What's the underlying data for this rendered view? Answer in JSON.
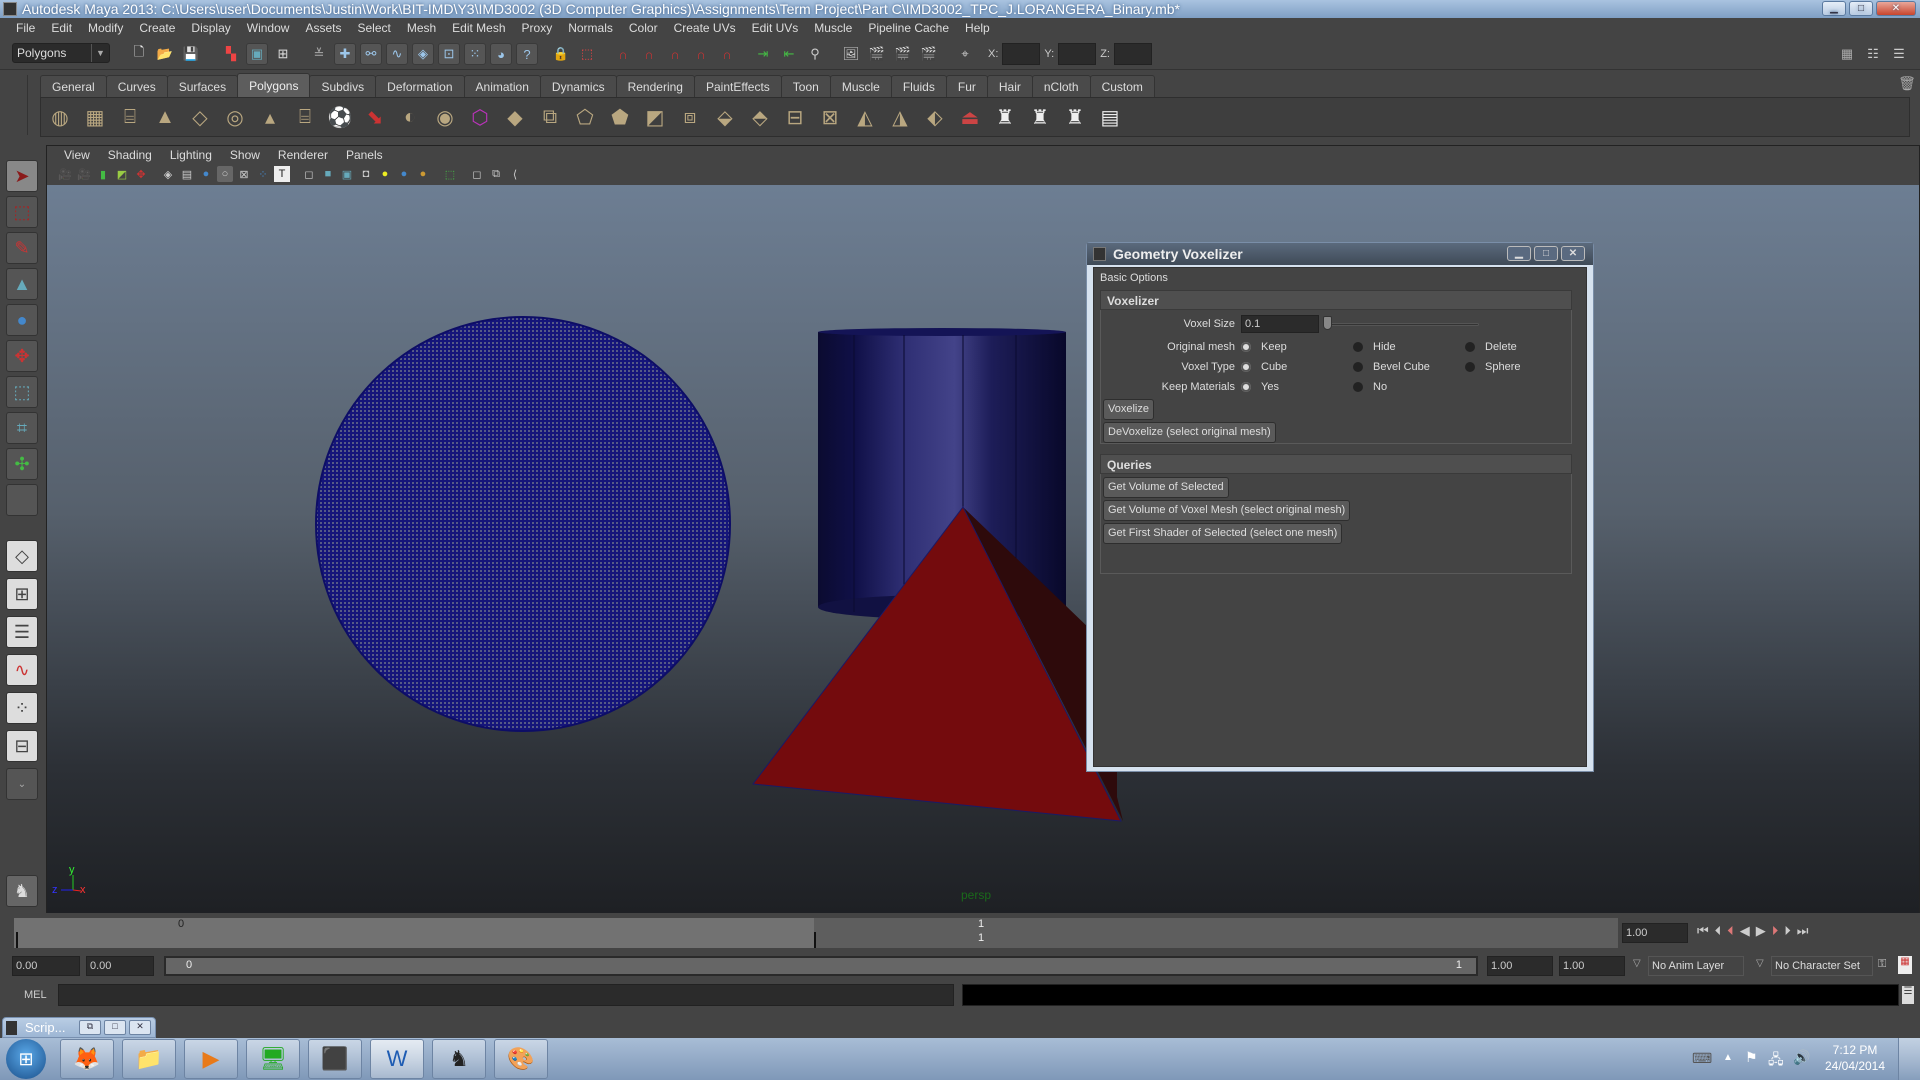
{
  "window": {
    "title": "Autodesk Maya 2013: C:\\Users\\user\\Documents\\Justin\\Work\\BIT-IMD\\Y3\\IMD3002 (3D Computer Graphics)\\Assignments\\Term Project\\Part C\\IMD3002_TPC_J.LORANGERA_Binary.mb*",
    "controls": [
      "minimize",
      "maximize",
      "close"
    ]
  },
  "menubar": [
    "File",
    "Edit",
    "Modify",
    "Create",
    "Display",
    "Window",
    "Assets",
    "Select",
    "Mesh",
    "Edit Mesh",
    "Proxy",
    "Normals",
    "Color",
    "Create UVs",
    "Edit UVs",
    "Muscle",
    "Pipeline Cache",
    "Help"
  ],
  "statusline": {
    "mode": "Polygons",
    "icons": [
      "new-scene",
      "open-scene",
      "save-scene",
      "select-by-hierarchy",
      "select-by-object",
      "select-by-component",
      "snap-grid",
      "snap-curve",
      "snap-point",
      "snap-view-plane",
      "snap-live",
      "snap-surface",
      "snap-dynamics",
      "help-query",
      "lock",
      "select-highlight",
      "history-1",
      "history-2",
      "history-3",
      "history-4",
      "history-5",
      "input-ops",
      "output-ops",
      "construction-history",
      "render-view",
      "render-current",
      "ipr-render",
      "render-settings",
      "transform-input"
    ],
    "coords": {
      "x_label": "X:",
      "y_label": "Y:",
      "z_label": "Z:",
      "x": "",
      "y": "",
      "z": ""
    },
    "right_icons": [
      "attribute-editor",
      "tool-settings",
      "channel-box"
    ]
  },
  "shelf": {
    "tabs": [
      "General",
      "Curves",
      "Surfaces",
      "Polygons",
      "Subdivs",
      "Deformation",
      "Animation",
      "Dynamics",
      "Rendering",
      "PaintEffects",
      "Toon",
      "Muscle",
      "Fluids",
      "Fur",
      "Hair",
      "nCloth",
      "Custom"
    ],
    "active_tab": "Polygons",
    "icons": [
      "poly-sphere",
      "poly-cube",
      "poly-cylinder",
      "poly-cone",
      "poly-plane",
      "poly-torus",
      "poly-pyramid",
      "poly-pipe",
      "poly-soccer-ball",
      "separate",
      "combine",
      "smooth",
      "extract",
      "booleans",
      "mirror",
      "create-polygon",
      "append-polygon",
      "extrude",
      "bridge",
      "bevel",
      "split-polygon",
      "insert-edge-loop",
      "offset-edge-loop",
      "poke",
      "wedge",
      "sculpt",
      "planar-mapping",
      "cylindrical-mapping",
      "spherical-mapping",
      "automatic-mapping",
      "uv-editor"
    ],
    "trash_icon": "trash-icon"
  },
  "toolbox": [
    "select-tool",
    "lasso-tool",
    "paint-select-tool",
    "move-tool",
    "rotate-tool",
    "scale-tool",
    "universal-manipulator",
    "soft-mod-tool",
    "show-manipulator",
    "last-tool",
    "single-perspective-layout",
    "four-view-layout",
    "outliner-persp-layout",
    "persp-graph-layout",
    "hypershade-persp-layout",
    "persp-graph-hyper-layout",
    "more-layouts"
  ],
  "viewport": {
    "menu": [
      "View",
      "Shading",
      "Lighting",
      "Show",
      "Renderer",
      "Panels"
    ],
    "camera_label": "persp",
    "axis": {
      "x": "x",
      "y": "y",
      "z": "z"
    },
    "scene_objects": [
      {
        "name": "voxelized-sphere",
        "color": "#0d0d66"
      },
      {
        "name": "cylinder",
        "color": "#3a3a82"
      },
      {
        "name": "pyramid",
        "color": "#740b0d"
      }
    ]
  },
  "dialog": {
    "title": "Geometry Voxelizer",
    "menu": "Basic Options",
    "voxelizer": {
      "header": "Voxelizer",
      "voxel_size_label": "Voxel Size",
      "voxel_size": "0.1",
      "voxel_size_slider": 0.0,
      "original_mesh": {
        "label": "Original mesh",
        "options": [
          "Keep",
          "Hide",
          "Delete"
        ],
        "selected": "Keep"
      },
      "voxel_type": {
        "label": "Voxel Type",
        "options": [
          "Cube",
          "Bevel Cube",
          "Sphere"
        ],
        "selected": "Cube"
      },
      "keep_materials": {
        "label": "Keep Materials",
        "options": [
          "Yes",
          "No"
        ],
        "selected": "Yes"
      },
      "voxelize_btn": "Voxelize",
      "devoxelize_btn": "DeVoxelize (select original mesh)"
    },
    "queries": {
      "header": "Queries",
      "buttons": [
        "Get Volume of Selected",
        "Get Volume of Voxel Mesh (select original mesh)",
        "Get First Shader of Selected (select one mesh)"
      ]
    }
  },
  "timeline": {
    "start_tick": "0",
    "current_frame_top": "1",
    "current_frame_bottom": "1",
    "current_time": "1.00",
    "playback": [
      "go-to-start",
      "step-back-frame",
      "step-back-key",
      "play-backwards",
      "play-forwards",
      "step-forward-key",
      "step-forward-frame",
      "go-to-end"
    ]
  },
  "range": {
    "start_time": "0.00",
    "playback_start": "0.00",
    "slider_start": "0",
    "slider_end": "1",
    "playback_end": "1.00",
    "end_time": "1.00",
    "anim_layer": "No Anim Layer",
    "character_set": "No Character Set"
  },
  "commandline": {
    "label": "MEL",
    "input": "",
    "result": ""
  },
  "script_editor_mini": {
    "label": "Scrip..."
  },
  "taskbar": {
    "apps": [
      "start-button",
      "firefox",
      "file-explorer",
      "media-player",
      "resource-monitor",
      "adobe-reader",
      "microsoft-word",
      "autodesk-maya",
      "paint"
    ],
    "time": "7:12 PM",
    "date": "24/04/2014",
    "tray": [
      "keyboard-icon",
      "show-hidden-icon",
      "action-center-flag-icon",
      "network-icon",
      "volume-icon"
    ]
  }
}
